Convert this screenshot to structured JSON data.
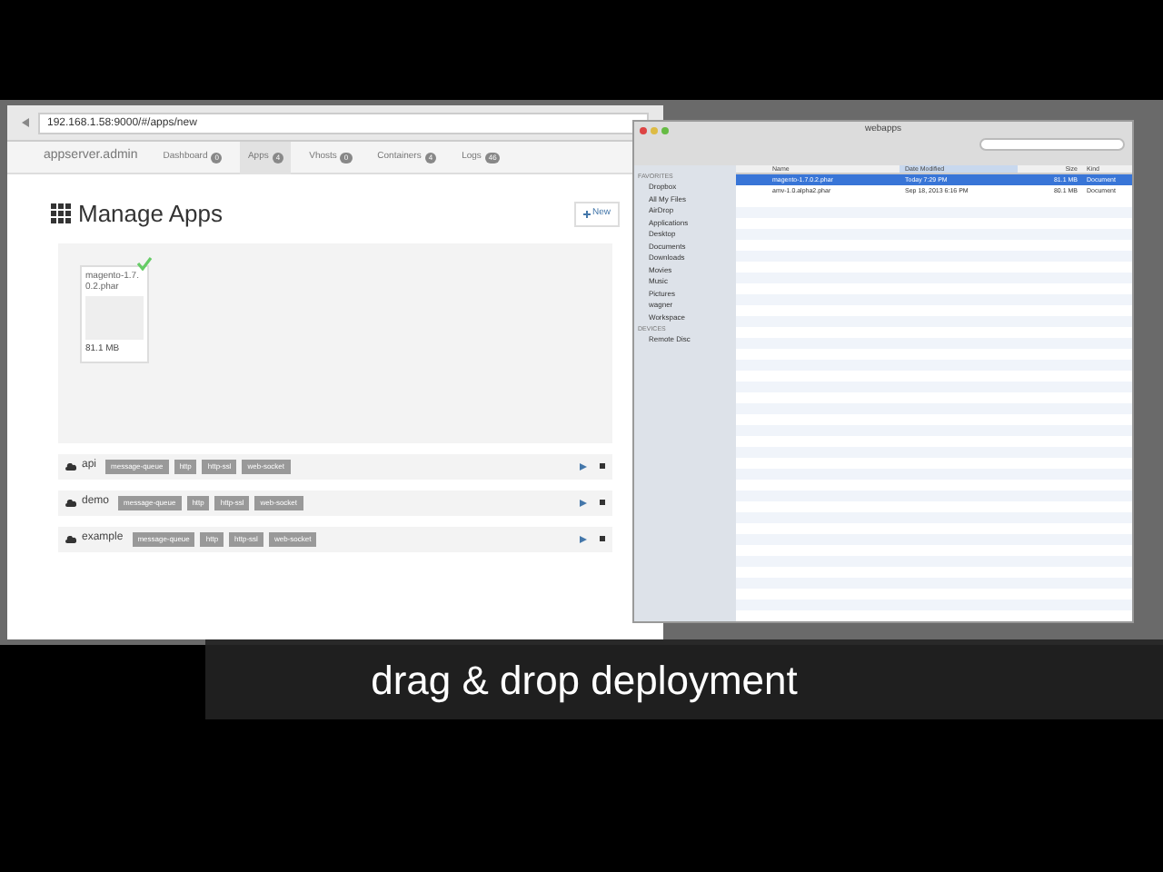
{
  "browser": {
    "url": "192.168.1.58:9000/#/apps/new",
    "brand": "appserver.admin",
    "nav": [
      {
        "label": "Dashboard",
        "count": "0",
        "selected": false
      },
      {
        "label": "Apps",
        "count": "4",
        "selected": true
      },
      {
        "label": "Vhosts",
        "count": "0",
        "selected": false
      },
      {
        "label": "Containers",
        "count": "4",
        "selected": false
      },
      {
        "label": "Logs",
        "count": "46",
        "selected": false
      }
    ],
    "page_title": "Manage Apps",
    "new_button": "New",
    "upload": {
      "name": "magento-1.7.0.2.phar",
      "size": "81.1 MB",
      "done": true
    },
    "apps": [
      {
        "name": "api",
        "tags": [
          "message-queue",
          "http",
          "http-ssl",
          "web-socket"
        ]
      },
      {
        "name": "demo",
        "tags": [
          "message-queue",
          "http",
          "http-ssl",
          "web-socket"
        ]
      },
      {
        "name": "example",
        "tags": [
          "message-queue",
          "http",
          "http-ssl",
          "web-socket"
        ]
      }
    ]
  },
  "finder": {
    "title": "webapps",
    "sidebar": [
      {
        "heading": "FAVORITES",
        "items": [
          "Dropbox",
          "All My Files",
          "AirDrop",
          "Applications",
          "Desktop",
          "Documents",
          "Downloads",
          "Movies",
          "Music",
          "Pictures",
          "wagner",
          "Workspace"
        ]
      },
      {
        "heading": "DEVICES",
        "items": [
          "Remote Disc"
        ]
      }
    ],
    "columns": [
      "Name",
      "Date Modified",
      "Size",
      "Kind"
    ],
    "rows": [
      {
        "cells": [
          "magento-1.7.0.2.phar",
          "Today 7:29 PM",
          "81.1 MB",
          "Document"
        ],
        "selected": true
      },
      {
        "cells": [
          "amv-1.0.alpha2.phar",
          "Sep 18, 2013 6:16 PM",
          "80.1 MB",
          "Document"
        ],
        "selected": false
      }
    ]
  },
  "caption": "drag & drop deployment"
}
